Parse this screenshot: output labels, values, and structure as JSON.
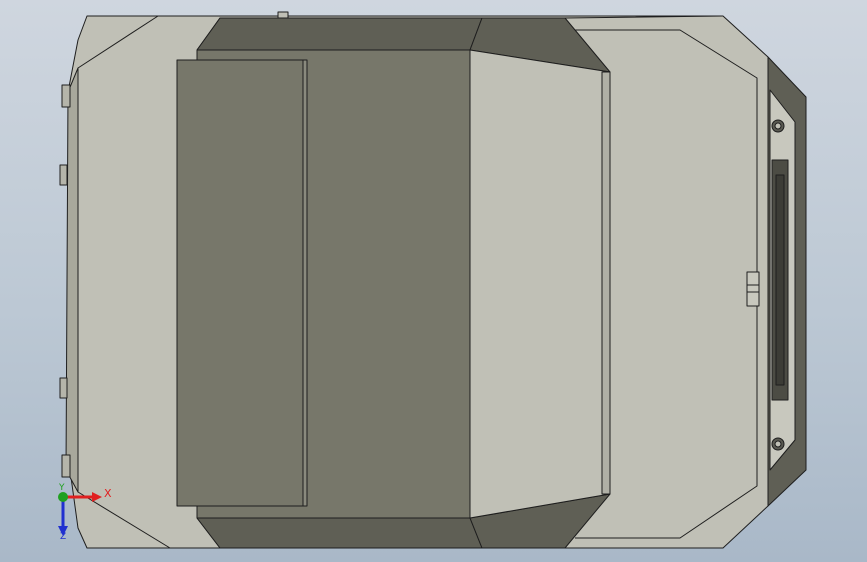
{
  "colors": {
    "background_top": "#cfd6df",
    "background_bottom": "#a9b8c8",
    "face_light": "#c0c0b6",
    "face_dark": "#77776a",
    "face_darker": "#5f5f55",
    "edge": "#1e1e1e",
    "axis_x": "#e02020",
    "axis_y": "#20a020",
    "axis_z": "#2030d0"
  },
  "triad": {
    "x_label": "X",
    "y_label": "Y",
    "z_label": "Z"
  }
}
